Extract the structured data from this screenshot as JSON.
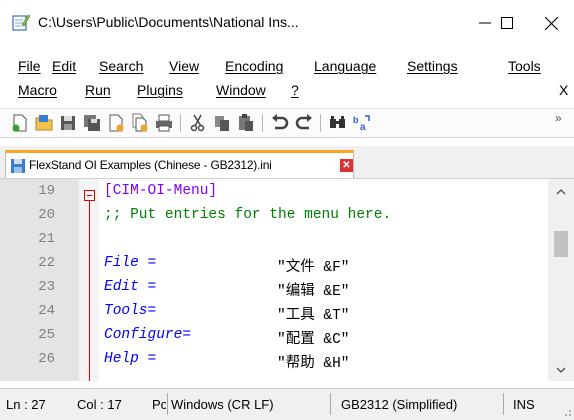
{
  "window": {
    "title": "C:\\Users\\Public\\Documents\\National Ins...",
    "minimize_glyph": "—",
    "maximize_glyph": "☐",
    "close_glyph": "✕"
  },
  "menu": {
    "row1": [
      "File",
      "Edit",
      "Search",
      "View",
      "Encoding",
      "Language",
      "Settings",
      "Tools"
    ],
    "row2": [
      "Macro",
      "Run",
      "Plugins",
      "Window",
      "?"
    ],
    "close_doc": "X"
  },
  "toolbar": {
    "icons": [
      "new-file-icon",
      "open-file-icon",
      "save-icon",
      "save-all-icon",
      "close-icon",
      "close-all-icon",
      "print-icon",
      "cut-icon",
      "copy-icon",
      "paste-icon",
      "undo-icon",
      "redo-icon",
      "find-icon",
      "replace-icon"
    ],
    "overflow": "»"
  },
  "tab": {
    "label": "FlexStand OI Examples (Chinese - GB2312).ini",
    "close": "✕"
  },
  "editor": {
    "lines": [
      {
        "num": "19",
        "section": "[CIM-OI-Menu]"
      },
      {
        "num": "20",
        "comment": ";; Put entries for the menu here."
      },
      {
        "num": "21"
      },
      {
        "num": "22",
        "key": "File =",
        "value": "\"文件 &F\""
      },
      {
        "num": "23",
        "key": "Edit =",
        "value": "\"编辑 &E\""
      },
      {
        "num": "24",
        "key": "Tools=",
        "value": "\"工具 &T\""
      },
      {
        "num": "25",
        "key": "Configure=",
        "value": "\"配置 &C\""
      },
      {
        "num": "26",
        "key": "Help =",
        "value": "\"帮助 &H\""
      }
    ]
  },
  "status": {
    "ln": "Ln : 27",
    "col": "Col : 17",
    "pos": "Pos",
    "eol": "Windows (CR LF)",
    "encoding": "GB2312 (Simplified)",
    "mode": "INS"
  },
  "colors": {
    "key": "#0000ff",
    "section": "#8000ff",
    "comment": "#008000",
    "fold": "#e00000",
    "tab_accent": "#f5a623"
  }
}
